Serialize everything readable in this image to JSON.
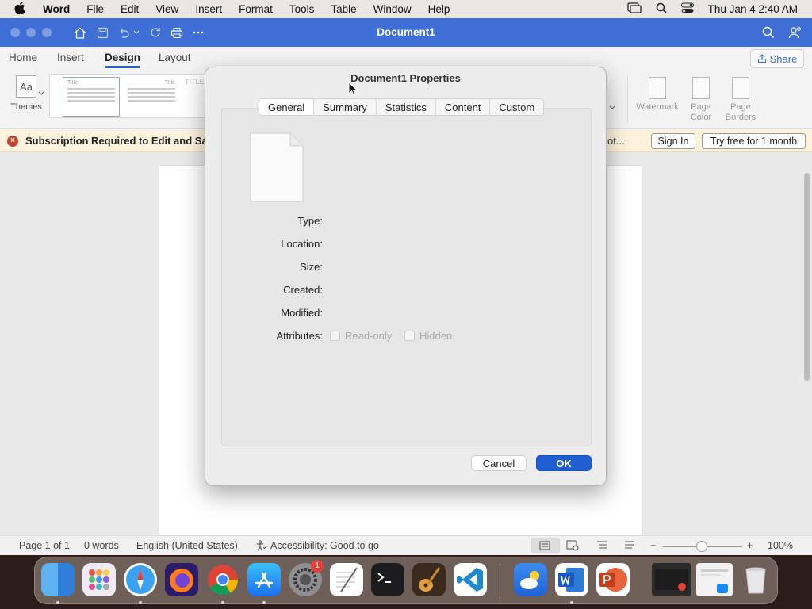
{
  "menubar": {
    "app": "Word",
    "items": [
      "File",
      "Edit",
      "View",
      "Insert",
      "Format",
      "Tools",
      "Table",
      "Window",
      "Help"
    ],
    "datetime": "Thu Jan 4  2:40 AM"
  },
  "window": {
    "title": "Document1",
    "tabs": [
      "Home",
      "Insert",
      "Design",
      "Layout"
    ],
    "active_tab": "Design",
    "share_label": "Share"
  },
  "ribbon": {
    "themes_label": "Themes",
    "aa_label": "Aa",
    "style_thumb_1": "Title",
    "style_thumb_2": "Title",
    "style_thumb_3": "TITLE",
    "watermark_label": "Watermark",
    "page_color_label": "Page Color",
    "page_borders_label": "Page Borders"
  },
  "banner": {
    "message": "Subscription Required to Edit and Save",
    "message_tail": "ot...",
    "sign_in_label": "Sign In",
    "try_free_label": "Try free for 1 month"
  },
  "dialog": {
    "title": "Document1 Properties",
    "tabs": [
      "General",
      "Summary",
      "Statistics",
      "Content",
      "Custom"
    ],
    "selected_tab": "General",
    "fields": {
      "type": "Type:",
      "location": "Location:",
      "size": "Size:",
      "created": "Created:",
      "modified": "Modified:",
      "attributes": "Attributes:"
    },
    "readonly_label": "Read-only",
    "hidden_label": "Hidden",
    "cancel_label": "Cancel",
    "ok_label": "OK"
  },
  "statusbar": {
    "page": "Page 1 of 1",
    "words": "0 words",
    "language": "English (United States)",
    "accessibility": "Accessibility: Good to go",
    "zoom": "100%"
  },
  "dock": {
    "badge_count": "1"
  }
}
